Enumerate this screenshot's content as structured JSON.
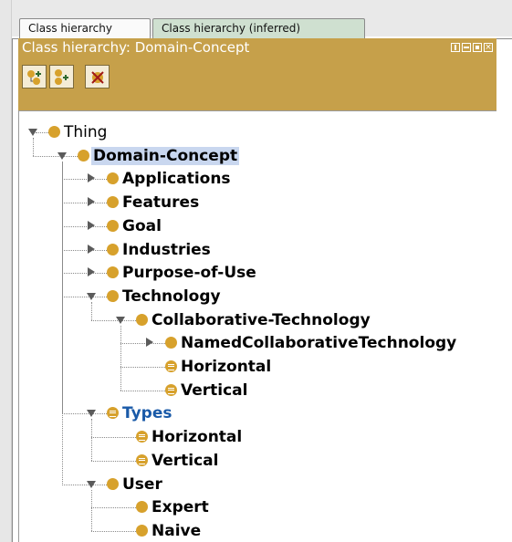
{
  "tabs": [
    {
      "label": "Class hierarchy",
      "active": true
    },
    {
      "label": "Class hierarchy (inferred)",
      "active": false
    }
  ],
  "view": {
    "title": "Class hierarchy: Domain-Concept",
    "controls": [
      "pin-icon",
      "minimize-icon",
      "maximize-icon",
      "close-icon"
    ]
  },
  "toolbar": {
    "buttons": [
      {
        "name": "add-subclass-button",
        "icon": "add-subclass-icon"
      },
      {
        "name": "add-sibling-button",
        "icon": "add-sibling-class-icon"
      },
      {
        "name": "delete-class-button",
        "icon": "delete-class-icon"
      }
    ]
  },
  "colors": {
    "header_bg": "#c6a04a",
    "class_dot": "#d7a12c",
    "selection": "#c9d7ef",
    "defined_class_text": "#1a5aa8"
  },
  "tree": {
    "nodes": [
      {
        "label": "Thing",
        "level": 0,
        "expander": "expanded",
        "icon": "class",
        "bold": false
      },
      {
        "label": "Domain-Concept",
        "level": 1,
        "expander": "expanded",
        "icon": "class",
        "bold": true,
        "selected": true
      },
      {
        "label": "Applications",
        "level": 2,
        "expander": "collapsed",
        "icon": "class",
        "bold": true
      },
      {
        "label": "Features",
        "level": 2,
        "expander": "collapsed",
        "icon": "class",
        "bold": true
      },
      {
        "label": "Goal",
        "level": 2,
        "expander": "collapsed",
        "icon": "class",
        "bold": true
      },
      {
        "label": "Industries",
        "level": 2,
        "expander": "collapsed",
        "icon": "class",
        "bold": true
      },
      {
        "label": "Purpose-of-Use",
        "level": 2,
        "expander": "collapsed",
        "icon": "class",
        "bold": true
      },
      {
        "label": "Technology",
        "level": 2,
        "expander": "expanded",
        "icon": "class",
        "bold": true
      },
      {
        "label": "Collaborative-Technology",
        "level": 3,
        "expander": "expanded",
        "icon": "class",
        "bold": true
      },
      {
        "label": "NamedCollaborativeTechnology",
        "level": 4,
        "expander": "collapsed",
        "icon": "class",
        "bold": true
      },
      {
        "label": "Horizontal",
        "level": 4,
        "expander": "leaf",
        "icon": "defined-class",
        "bold": true
      },
      {
        "label": "Vertical",
        "level": 4,
        "expander": "leaf",
        "icon": "defined-class",
        "bold": true
      },
      {
        "label": "Types",
        "level": 2,
        "expander": "expanded",
        "icon": "defined-class",
        "bold": true,
        "blue": true
      },
      {
        "label": "Horizontal",
        "level": 3,
        "expander": "leaf",
        "icon": "defined-class",
        "bold": true
      },
      {
        "label": "Vertical",
        "level": 3,
        "expander": "leaf",
        "icon": "defined-class",
        "bold": true
      },
      {
        "label": "User",
        "level": 2,
        "expander": "expanded",
        "icon": "class",
        "bold": true
      },
      {
        "label": "Expert",
        "level": 3,
        "expander": "leaf",
        "icon": "class",
        "bold": true
      },
      {
        "label": "Naive",
        "level": 3,
        "expander": "leaf",
        "icon": "class",
        "bold": true
      }
    ]
  }
}
